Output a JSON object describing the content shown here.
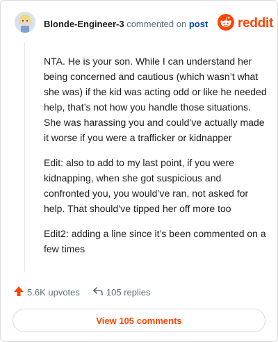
{
  "header": {
    "username": "Blonde-Engineer-3",
    "commented_on": "commented on",
    "post_link": "post",
    "logo_text": "reddit"
  },
  "comment": {
    "paragraphs": [
      "NTA. He is your son. While I can understand her being concerned and cautious (which wasn’t what she was) if the kid was acting odd or like he needed help, that’s not how you handle those situations. She was harassing you and could’ve actually made it worse if you were a trafficker or kidnapper",
      "Edit: also to add to my last point, if you were kidnapping, when she got suspicious and confronted you, you would’ve ran, not asked for help. That should’ve tipped her off more too",
      "Edit2: adding a line since it’s been commented on a few times"
    ]
  },
  "actions": {
    "upvotes": "5.6K upvotes",
    "replies": "105 replies"
  },
  "view_button": "View 105 comments",
  "colors": {
    "brand": "#ff4500",
    "link": "#0045ac",
    "muted": "#576f76"
  },
  "icons": [
    "avatar",
    "reddit-logo-icon",
    "upvote-arrow-icon",
    "reply-arrow-icon"
  ]
}
